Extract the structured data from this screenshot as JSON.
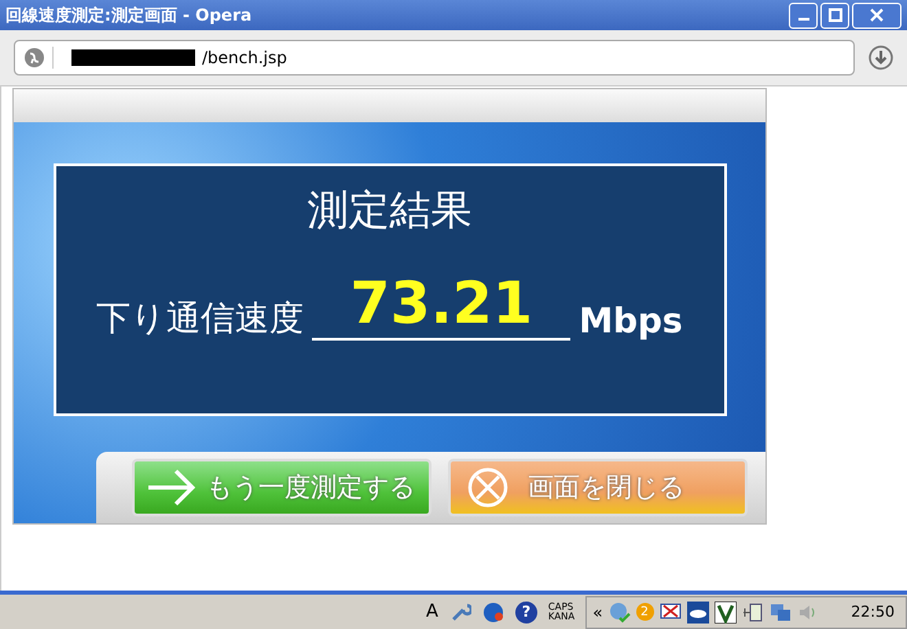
{
  "window": {
    "title": "回線速度測定:測定画面 - Opera"
  },
  "address_bar": {
    "value": "/bench.jsp"
  },
  "page": {
    "heading": "測定結果",
    "speed_label": "下り通信速度",
    "speed_value": "73.21",
    "speed_unit": "Mbps",
    "buttons": [
      {
        "kind": "retry",
        "label": "もう一度測定する"
      },
      {
        "kind": "close",
        "label": "画面を閉じる"
      }
    ]
  },
  "taskbar": {
    "language": "A",
    "caps": "CAPS",
    "kana": "KANA",
    "tray_expand": "«",
    "clock": "22:50",
    "badge": "2",
    "help": "?"
  }
}
